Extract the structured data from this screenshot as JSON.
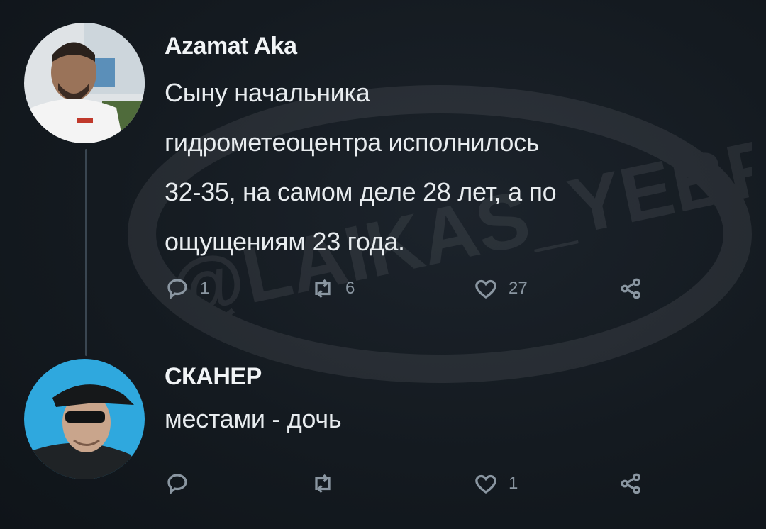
{
  "tweets": [
    {
      "author": "Azamat Aka",
      "text_lines": [
        "Сыну начальника",
        "гидрометеоцентра исполнилось",
        "32-35, на самом деле 28 лет, а по",
        "ощущениям 23 года."
      ],
      "replies": "1",
      "retweets": "6",
      "likes": "27"
    },
    {
      "author": "СКАНЕР",
      "text_lines": [
        "местами - дочь"
      ],
      "replies": "",
      "retweets": "",
      "likes": "1"
    }
  ],
  "watermark": "@LAIKAS_YEBROV",
  "icons": [
    "reply-icon",
    "retweet-icon",
    "like-icon",
    "share-icon"
  ],
  "colors": {
    "background": "#151b22",
    "text": "#e8ecef",
    "muted": "#8a96a1"
  }
}
